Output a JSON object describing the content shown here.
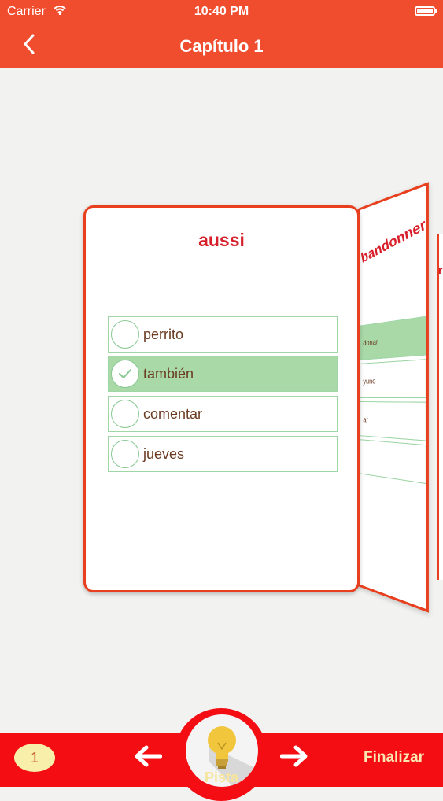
{
  "status_bar": {
    "carrier": "Carrier",
    "time": "10:40 PM"
  },
  "nav": {
    "title": "Capítulo 1",
    "back_icon": "chevron-left-icon"
  },
  "card": {
    "word": "aussi",
    "options": [
      {
        "label": "perrito",
        "selected": false
      },
      {
        "label": "también",
        "selected": true
      },
      {
        "label": "comentar",
        "selected": false
      },
      {
        "label": "jueves",
        "selected": false
      }
    ]
  },
  "next_card": {
    "word": "bandonner",
    "options": [
      "donar",
      "yuno",
      "ar",
      ""
    ]
  },
  "edge_card": {
    "word": "re"
  },
  "bottom": {
    "counter": "1",
    "hint_label": "Pista",
    "finish_label": "Finalizar"
  },
  "colors": {
    "accent": "#f04d2f",
    "bottom_bar": "#f40e14",
    "word": "#d71f2a",
    "selected_option": "#a8d9a6"
  }
}
